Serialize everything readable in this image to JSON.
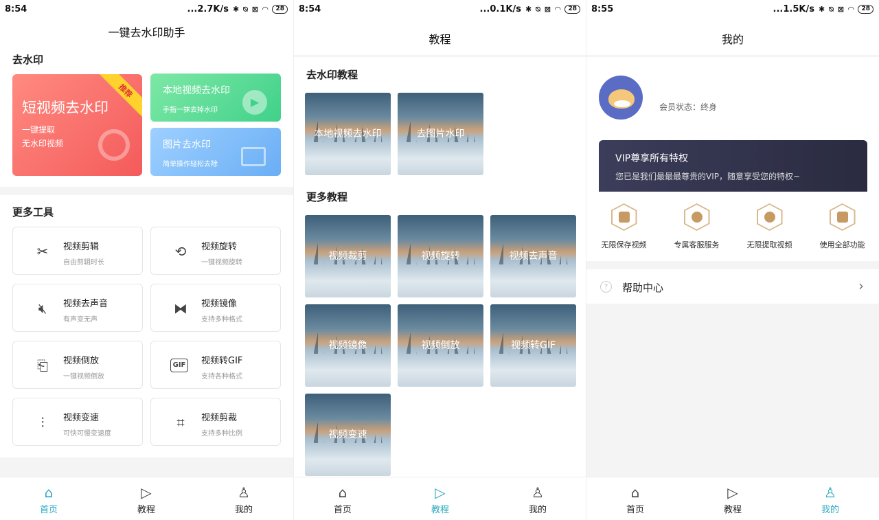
{
  "screens": [
    {
      "status": {
        "time": "8:54",
        "speed": "...2.7K/s",
        "battery": "28"
      }
    },
    {
      "status": {
        "time": "8:54",
        "speed": "...0.1K/s",
        "battery": "28"
      }
    },
    {
      "status": {
        "time": "8:55",
        "speed": "...1.5K/s",
        "battery": "28"
      }
    }
  ],
  "home": {
    "title": "一键去水印助手",
    "section_main": "去水印",
    "featured": {
      "title": "短视频去水印",
      "line1": "一键提取",
      "line2": "无水印视频",
      "badge": "推荐"
    },
    "local": {
      "title": "本地视频去水印",
      "sub": "手指一抹去掉水印"
    },
    "image": {
      "title": "图片去水印",
      "sub": "简单操作轻松去除"
    },
    "section_tools": "更多工具",
    "tools": [
      {
        "title": "视频剪辑",
        "sub": "自由剪辑时长",
        "icon": "scissors-icon"
      },
      {
        "title": "视频旋转",
        "sub": "一键视频旋转",
        "icon": "rotate-icon"
      },
      {
        "title": "视频去声音",
        "sub": "有声变无声",
        "icon": "mute-icon"
      },
      {
        "title": "视频镜像",
        "sub": "支持多种格式",
        "icon": "mirror-icon"
      },
      {
        "title": "视频倒放",
        "sub": "一键视频倒放",
        "icon": "reverse-icon"
      },
      {
        "title": "视频转GIF",
        "sub": "支持各种格式",
        "icon": "gif-icon"
      },
      {
        "title": "视频变速",
        "sub": "可快可慢变速度",
        "icon": "speed-icon"
      },
      {
        "title": "视频剪裁",
        "sub": "支持多种比例",
        "icon": "crop-icon"
      }
    ]
  },
  "tutorial": {
    "title": "教程",
    "section_main": "去水印教程",
    "main_items": [
      "本地视频去水印",
      "去图片水印"
    ],
    "section_more": "更多教程",
    "more_items": [
      "视频裁剪",
      "视频旋转",
      "视频去声音",
      "视频镜像",
      "视频倒放",
      "视频转GIF",
      "视频变速"
    ]
  },
  "mine": {
    "title": "我的",
    "member_status": "会员状态：终身",
    "vip_title": "VIP尊享所有特权",
    "vip_sub": "您已是我们最最最尊贵的VIP，随意享受您的特权~",
    "privileges": [
      "无限保存视频",
      "专属客服服务",
      "无限提取视频",
      "使用全部功能"
    ],
    "help": "帮助中心"
  },
  "nav": {
    "home": "首页",
    "tutorial": "教程",
    "mine": "我的"
  },
  "colors": {
    "accent": "#2aa9c1",
    "featured": "#f45b5b",
    "local": "#40d18a",
    "image": "#6aaef5",
    "vip_bg": "#2f3048"
  }
}
